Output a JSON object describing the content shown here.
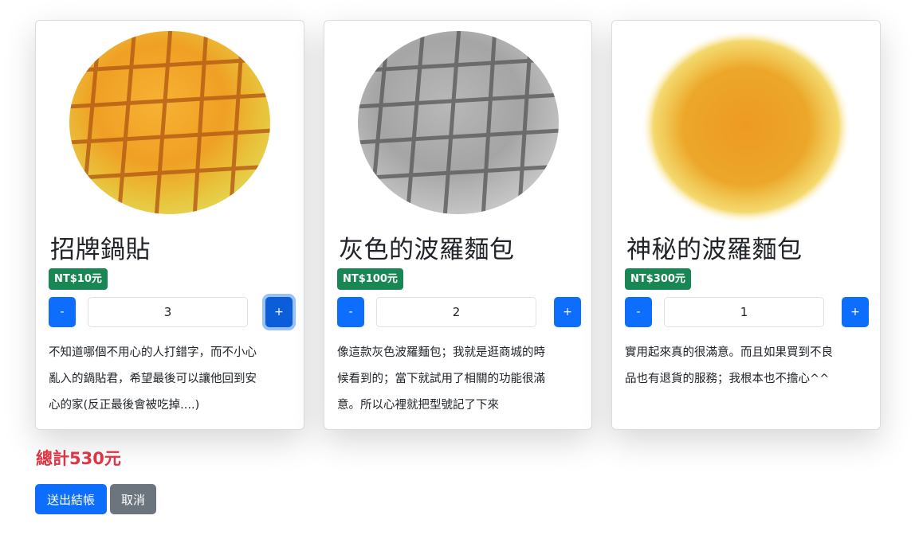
{
  "products": [
    {
      "title": "招牌鍋貼",
      "price": "NT$10元",
      "quantity": "3",
      "minus_label": "-",
      "plus_label": "+",
      "desc_lines": [
        "不知道哪個不用心的人打錯字，而不小心",
        "亂入的鍋貼君，希望最後可以讓他回到安",
        "心的家(反正最後會被吃掉....)"
      ],
      "image": "pineapple-bun-color"
    },
    {
      "title": "灰色的波羅麵包",
      "price": "NT$100元",
      "quantity": "2",
      "minus_label": "-",
      "plus_label": "+",
      "desc_lines": [
        "像這款灰色波羅麵包；我就是逛商城的時",
        "候看到的；當下就試用了相關的功能很滿",
        "意。所以心裡就把型號記了下來"
      ],
      "image": "pineapple-bun-grayscale"
    },
    {
      "title": "神秘的波羅麵包",
      "price": "NT$300元",
      "quantity": "1",
      "minus_label": "-",
      "plus_label": "+",
      "desc_lines": [
        "實用起來真的很滿意。而且如果買到不良",
        "品也有退貨的服務；我根本也不擔心^^"
      ],
      "image": "pineapple-bun-blurred"
    }
  ],
  "total_label": "總計530元",
  "submit_label": "送出結帳",
  "cancel_label": "取消",
  "colors": {
    "primary": "#0d6efd",
    "success": "#198754",
    "danger": "#dc3545",
    "secondary": "#6c757d"
  }
}
